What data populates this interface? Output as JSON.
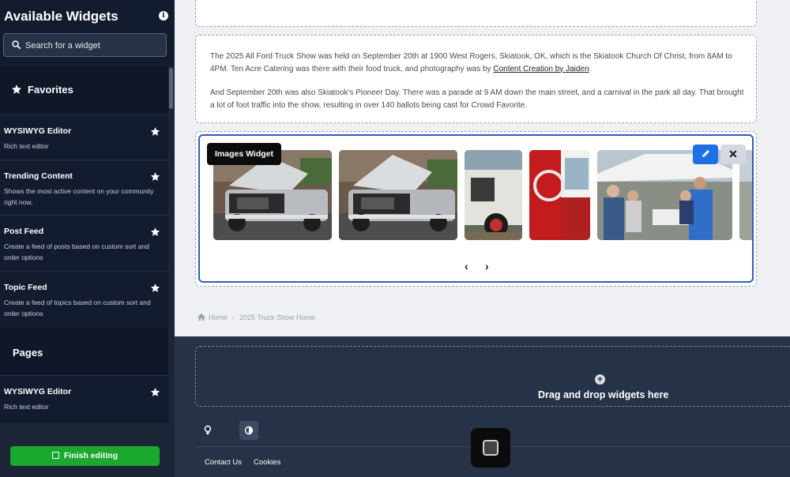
{
  "sidebar": {
    "title": "Available Widgets",
    "search_placeholder": "Search for a widget",
    "favorites_label": "Favorites",
    "pages_label": "Pages",
    "favorites": [
      {
        "name": "WYSIWYG Editor",
        "desc": "Rich text editor"
      },
      {
        "name": "Trending Content",
        "desc": "Shows the most active content on your community right now."
      },
      {
        "name": "Post Feed",
        "desc": "Create a feed of posts based on custom sort and order options"
      },
      {
        "name": "Topic Feed",
        "desc": "Create a feed of topics based on custom sort and order options"
      }
    ],
    "pages": [
      {
        "name": "WYSIWYG Editor",
        "desc": "Rich text editor"
      }
    ],
    "finish_label": "Finish editing"
  },
  "main": {
    "para1_pre": "The 2025 All Ford Truck Show was held on September 20th at 1900 West Rogers, Skiatook, OK, which is the Skiatook Church Of Christ, from 8AM to 4PM.  Ten Acre Catering was there with their food truck, and photography was by ",
    "para1_link": "Content Creation by Jaiden",
    "para1_post": ".",
    "para2": "And September 20th was also Skiatook's Pioneer Day.  There was a parade at 9 AM down the main street, and a carnival in the park all day.  That brought a lot of foot traffic into the show, resulting in over 140 ballots being cast for Crowd Favorite.",
    "images_widget_label": "Images Widget",
    "close_glyph": "✕",
    "prev_glyph": "‹",
    "next_glyph": "›"
  },
  "breadcrumb": {
    "home": "Home",
    "current": "2025 Truck Show Home"
  },
  "footer": {
    "drop_text": "Drag and drop widgets here",
    "plus_glyph": "+",
    "links": [
      "Contact Us",
      "Cookies"
    ]
  },
  "colors": {
    "sidebar_bg": "#131c2e",
    "accent_blue": "#1f6fe5",
    "finish_green": "#1aa82e",
    "footer_bg": "#263248"
  }
}
